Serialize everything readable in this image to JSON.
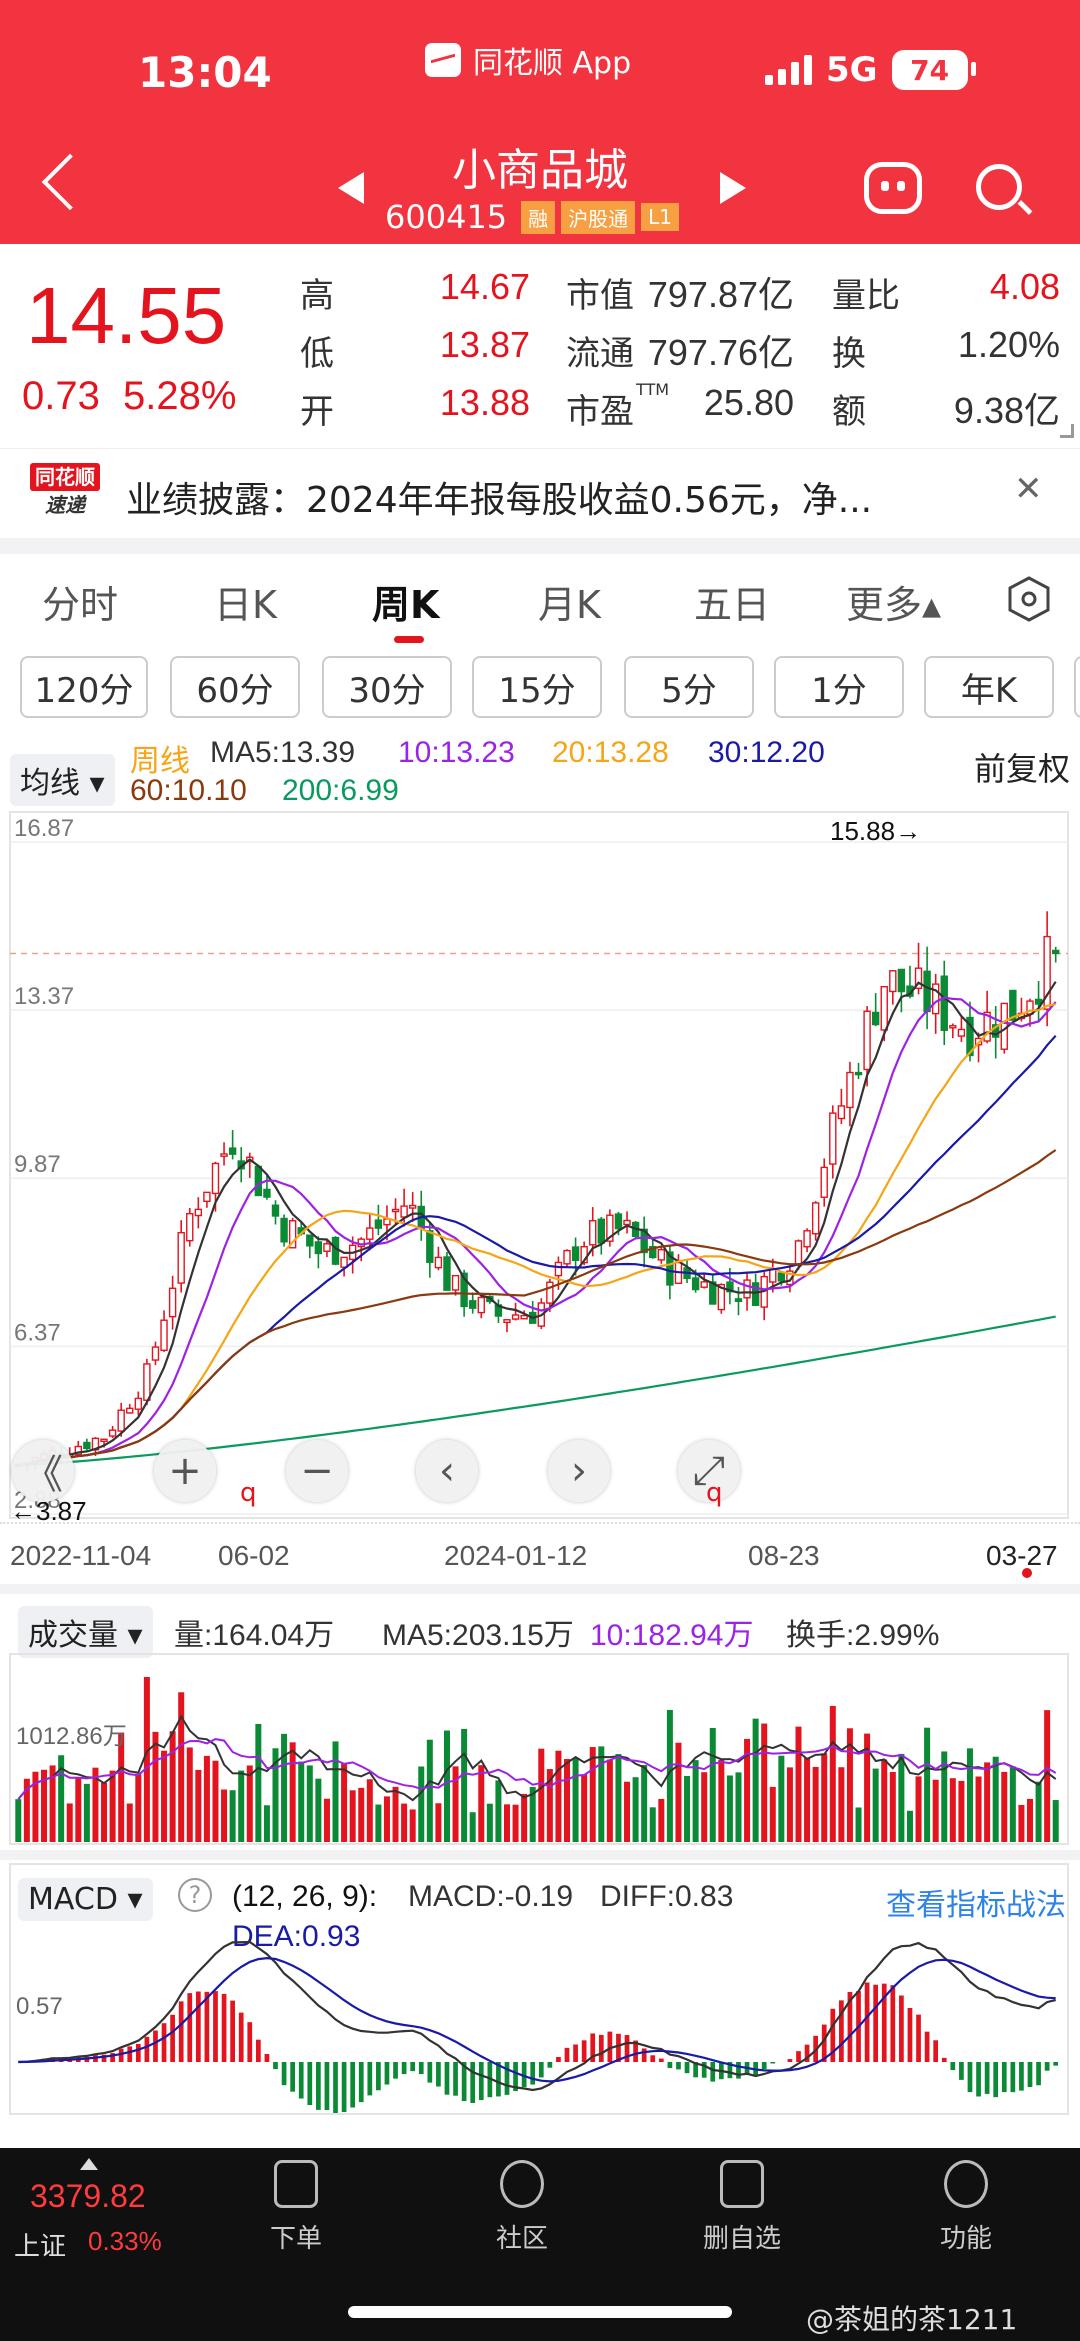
{
  "status": {
    "time": "13:04",
    "app": "同花顺 App",
    "network": "5G",
    "battery": "74"
  },
  "nav": {
    "title": "小商品城",
    "code": "600415",
    "tags": [
      "融",
      "沪股通",
      "L1"
    ]
  },
  "quote": {
    "price": "14.55",
    "change": "0.73",
    "pct": "5.28%",
    "stats": [
      {
        "l": "高",
        "v": "14.67"
      },
      {
        "l": "低",
        "v": "13.87"
      },
      {
        "l": "开",
        "v": "13.88"
      },
      {
        "l": "市值",
        "v": "797.87亿"
      },
      {
        "l": "流通",
        "v": "797.76亿"
      },
      {
        "l": "市盈",
        "v": "25.80",
        "sup": "TTM"
      },
      {
        "l": "量比",
        "v": "4.08"
      },
      {
        "l": "换",
        "v": "1.20%"
      },
      {
        "l": "额",
        "v": "9.38亿"
      }
    ]
  },
  "news": {
    "logo_top": "同花顺",
    "logo_bottom": "速递",
    "text": "业绩披露：2024年年报每股收益0.56元，净..."
  },
  "period_tabs": [
    "分时",
    "日K",
    "周K",
    "月K",
    "五日",
    "更多▴"
  ],
  "active_tab": "周K",
  "chips": [
    "120分",
    "60分",
    "30分",
    "15分",
    "5分",
    "1分",
    "年K"
  ],
  "main_chart": {
    "selector": "均线",
    "series_label": "周线",
    "ma": [
      {
        "t": "MA5:13.39",
        "c": "#333333"
      },
      {
        "t": "10:13.23",
        "c": "#9b22e6"
      },
      {
        "t": "20:13.28",
        "c": "#f5a516"
      },
      {
        "t": "30:12.20",
        "c": "#1a1aa8"
      },
      {
        "t": "60:10.10",
        "c": "#8a3a0e"
      },
      {
        "t": "200:6.99",
        "c": "#0a9a60"
      }
    ],
    "adjust": "前复权",
    "y_ticks": [
      "16.87",
      "13.37",
      "9.87",
      "6.37",
      "2.88"
    ],
    "high_label": "15.88→",
    "low_label": "←3.87",
    "x_ticks": [
      "2022-11-04",
      "06-02",
      "2024-01-12",
      "08-23",
      "03-27"
    ],
    "controls": [
      "《",
      "+",
      "−",
      "‹",
      "›",
      "⤢"
    ]
  },
  "volume": {
    "selector": "成交量",
    "items": [
      {
        "t": "量:164.04万",
        "c": "#333333"
      },
      {
        "t": "MA5:203.15万",
        "c": "#333333"
      },
      {
        "t": "10:182.94万",
        "c": "#9b22e6"
      },
      {
        "t": "换手:2.99%",
        "c": "#333333"
      }
    ],
    "y_tick": "1012.86万"
  },
  "macd": {
    "selector": "MACD",
    "params": "(12, 26, 9):",
    "macd": "MACD:-0.19",
    "diff": "DIFF:0.83",
    "dea": "DEA:0.93",
    "link": "查看指标战法",
    "y_tick": "0.57"
  },
  "chart_data": [
    {
      "type": "candlestick",
      "title": "周线",
      "y_range": [
        2.88,
        16.87
      ],
      "x_labels": [
        "2022-11-04",
        "06-02",
        "2024-01-12",
        "08-23",
        "03-27"
      ],
      "close_approx": [
        3.9,
        4.2,
        4.5,
        5.8,
        9.2,
        10.8,
        9.0,
        8.3,
        8.6,
        9.4,
        7.6,
        7.0,
        7.1,
        8.6,
        8.8,
        8.0,
        7.6,
        7.5,
        8.4,
        11.3,
        14.0,
        13.6,
        13.0,
        13.4,
        14.55
      ],
      "annotations": {
        "high": 15.88,
        "low": 3.87
      }
    },
    {
      "type": "bar",
      "title": "成交量",
      "y_tick": "1012.86万"
    },
    {
      "type": "bar",
      "title": "MACD",
      "params": [
        12,
        26,
        9
      ],
      "MACD": -0.19,
      "DIFF": 0.83,
      "DEA": 0.93
    }
  ],
  "bottom": {
    "index_value": "3379.82",
    "index_name": "上证",
    "index_pct": "0.33%",
    "items": [
      "下单",
      "社区",
      "删自选",
      "功能"
    ],
    "watermark": "@茶姐的茶1211"
  }
}
